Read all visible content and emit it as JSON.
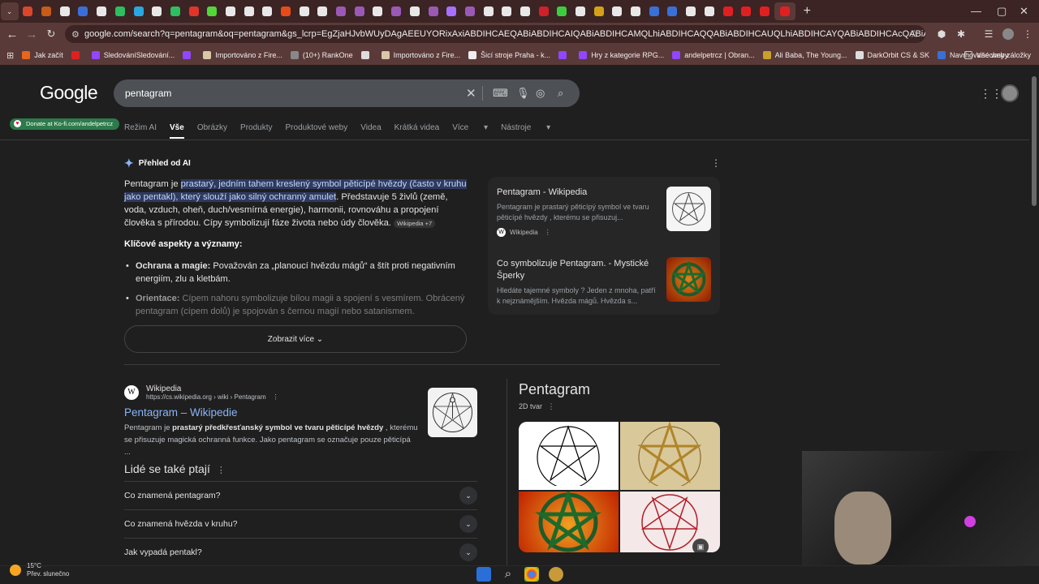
{
  "browser": {
    "tab_favicon_colors": [
      "#d9462b",
      "#c85a1a",
      "#e8e8e8",
      "#3b6fd8",
      "#e8e8e8",
      "#2dbe60",
      "#2aa7e0",
      "#e8e8e8",
      "#2dbe60",
      "#e0352b",
      "#53d639",
      "#e8e8e8",
      "#e8e8e8",
      "#e8e8e8",
      "#e84b1a",
      "#e8e8e8",
      "#e8e8e8",
      "#9b59b6",
      "#9b59b6",
      "#e8e8e8",
      "#9b59b6",
      "#e8e8e8",
      "#9b59b6",
      "#a970ff",
      "#9b59b6",
      "#e8e8e8",
      "#e8e8e8",
      "#e8e8e8",
      "#d0202a",
      "#3dcc3d",
      "#e8e8e8",
      "#d4a017",
      "#e8e8e8",
      "#e8e8e8",
      "#3b6fd8",
      "#3b6fd8",
      "#e8e8e8",
      "#e8e8e8",
      "#e02020",
      "#e02020",
      "#e02020",
      "#e02020"
    ],
    "new_tab": "+",
    "url": "google.com/search?q=pentagram&oq=pentagram&gs_lcrp=EgZjaHJvbWUyDAgAEEUYORixAxiABDIHCAEQABiABDIHCAIQABiABDIHCAMQLhiABDIHCAQQABiABDIHCAUQLhiABDIHCAYQABiABDIHCAcQABiABDIHCAgQABiABDINCAkQLhjHARjR...",
    "bookmarks": [
      {
        "label": "Jak začít",
        "color": "#e8661a"
      },
      {
        "label": "",
        "color": "#e02020"
      },
      {
        "label": "SledováníSledování...",
        "color": "#9146ff"
      },
      {
        "label": "",
        "color": "#9146ff"
      },
      {
        "label": "Importováno z Fire...",
        "color": "#d8c8a8"
      },
      {
        "label": "(10+) RankOne",
        "color": "#888"
      },
      {
        "label": "",
        "color": "#ddd"
      },
      {
        "label": "Importováno z Fire...",
        "color": "#d8c8a8"
      },
      {
        "label": "Šicí stroje Praha - k...",
        "color": "#eee"
      },
      {
        "label": "",
        "color": "#9146ff"
      },
      {
        "label": "Hry z kategorie RPG...",
        "color": "#9146ff"
      },
      {
        "label": "andelpetrcz | Obran...",
        "color": "#9146ff"
      },
      {
        "label": "Ali Baba, The Young...",
        "color": "#c8a030"
      },
      {
        "label": "DarkOrbit CS & SK",
        "color": "#ddd"
      },
      {
        "label": "Navrhované weby",
        "color": "#3b6fd8"
      }
    ],
    "all_bookmarks": "Všechny záložky"
  },
  "google": {
    "logo": "Google",
    "query": "pentagram",
    "tabs": [
      "Režim AI",
      "Vše",
      "Obrázky",
      "Produkty",
      "Produktové weby",
      "Videa",
      "Krátká videa",
      "Více",
      "Nástroje"
    ],
    "kofi": "Donate at Ko-fi.com/andelpetrcz"
  },
  "ai": {
    "title": "Přehled od AI",
    "intro": "Pentagram je ",
    "highlight": "prastarý, jedním tahem kreslený symbol pěticípé hvězdy (často v kruhu jako pentakl), který slouží jako silný ochranný amulet",
    "rest": ". Představuje 5 živlů (země, voda, vzduch, oheň, duch/vesmírná energie), harmonii, rovnováhu a propojení člověka s přírodou. Cípy symbolizují fáze života nebo údy člověka. ",
    "chip": "Wikipedia +7",
    "subtitle": "Klíčové aspekty a významy:",
    "b1_bold": "Ochrana a magie:",
    "b1_text": " Považován za „planoucí hvězdu mágů“ a štít proti negativním energiím, zlu a kletbám.",
    "b2_bold": "Orientace:",
    "b2_text": " Cípem nahoru symbolizuje bílou magii a spojení s vesmírem. Obrácený pentagram (cípem dolů) je spojován s černou magií nebo satanismem.",
    "show_more": "Zobrazit více",
    "sources": [
      {
        "title": "Pentagram - Wikipedia",
        "desc": "Pentagram je prastarý pěticípý symbol ve tvaru pěticípé hvězdy , kterému se přisuzuj...",
        "site": "Wikipedia"
      },
      {
        "title": "Co symbolizuje Pentagram. - Mystické Šperky",
        "desc": "Hledáte tajemné symboly ? Jeden z mnoha, patří k nejznámějším. Hvězda mágů. Hvězda s..."
      }
    ]
  },
  "result": {
    "site": "Wikipedia",
    "url": "https://cs.wikipedia.org › wiki › Pentagram",
    "title": "Pentagram – Wikipedie",
    "snip_a": "Pentagram je ",
    "snip_b": "prastarý předkřesťanský symbol ve tvaru pěticípé hvězdy",
    "snip_c": " , kterému se přisuzuje magická ochranná funkce. Jako pentagram se označuje pouze pěticípá ..."
  },
  "paa": {
    "title": "Lidé se také ptají",
    "q": [
      "Co znamená pentagram?",
      "Co znamená hvězda v kruhu?",
      "Jak vypadá pentakl?"
    ]
  },
  "kp": {
    "title": "Pentagram",
    "subtitle": "2D tvar"
  },
  "taskbar": {
    "temp": "15°C",
    "weather": "Přev. slunečno"
  }
}
